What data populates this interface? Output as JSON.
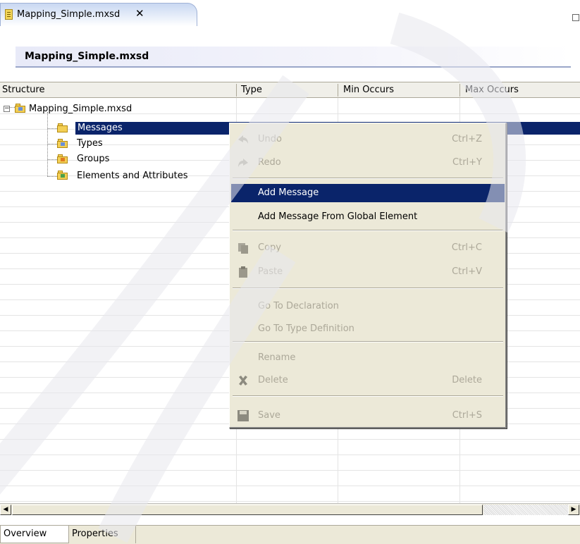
{
  "editor_tab": {
    "title": "Mapping_Simple.mxsd",
    "close_glyph": "✕"
  },
  "header": {
    "title": "Mapping_Simple.mxsd"
  },
  "columns": [
    "Structure",
    "Type",
    "Min Occurs",
    "Max Occurs"
  ],
  "tree": {
    "root": "Mapping_Simple.mxsd",
    "children": [
      "Messages",
      "Types",
      "Groups",
      "Elements and Attributes"
    ],
    "selected": "Messages"
  },
  "context_menu": {
    "undo": {
      "label": "Undo",
      "accel": "Ctrl+Z"
    },
    "redo": {
      "label": "Redo",
      "accel": "Ctrl+Y"
    },
    "add_message": {
      "label": "Add Message"
    },
    "add_message_global": {
      "label": "Add Message From Global Element"
    },
    "copy": {
      "label": "Copy",
      "accel": "Ctrl+C"
    },
    "paste": {
      "label": "Paste",
      "accel": "Ctrl+V"
    },
    "goto_decl": {
      "label": "Go To Declaration"
    },
    "goto_type": {
      "label": "Go To Type Definition"
    },
    "rename": {
      "label": "Rename"
    },
    "delete": {
      "label": "Delete",
      "accel": "Delete"
    },
    "save": {
      "label": "Save",
      "accel": "Ctrl+S"
    },
    "highlighted": "Add Message"
  },
  "scrollbar": {
    "left_arrow": "◀",
    "right_arrow": "▶"
  },
  "bottom_tabs": [
    "Overview",
    "Properties"
  ],
  "colors": {
    "selection": "#0a246a",
    "menu_bg": "#ece9d8",
    "header_bg": "#f0efe9"
  }
}
